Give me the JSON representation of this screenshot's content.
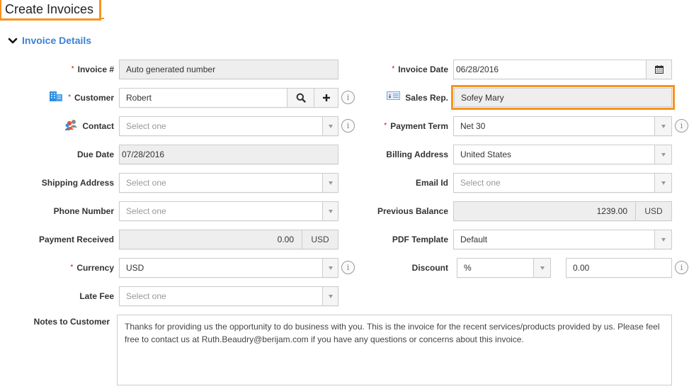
{
  "page": {
    "title": "Create Invoices"
  },
  "section": {
    "title": "Invoice Details",
    "expanded_icon": "chevron-down-icon"
  },
  "colors": {
    "accent_orange": "#f7941d",
    "section_blue": "#3b82d6",
    "required_red": "#dd0000"
  },
  "left": {
    "invoice_no": {
      "label": "Invoice #",
      "required": "*",
      "value": "Auto generated number"
    },
    "customer": {
      "label": "Customer",
      "required": "*",
      "value": "Robert",
      "icon": "building-icon",
      "search_icon": "search-icon",
      "add_icon": "plus-icon"
    },
    "contact": {
      "label": "Contact",
      "placeholder": "Select one",
      "icon": "contacts-icon"
    },
    "due_date": {
      "label": "Due Date",
      "value": "07/28/2016"
    },
    "shipping_address": {
      "label": "Shipping Address",
      "placeholder": "Select one"
    },
    "phone_number": {
      "label": "Phone Number",
      "placeholder": "Select one"
    },
    "payment_received": {
      "label": "Payment Received",
      "value": "0.00",
      "currency": "USD"
    },
    "currency": {
      "label": "Currency",
      "required": "*",
      "value": "USD"
    },
    "late_fee": {
      "label": "Late Fee",
      "placeholder": "Select one"
    }
  },
  "right": {
    "invoice_date": {
      "label": "Invoice Date",
      "required": "*",
      "value": "06/28/2016",
      "icon": "calendar-icon"
    },
    "sales_rep": {
      "label": "Sales Rep.",
      "value": "Sofey Mary",
      "icon": "id-card-icon"
    },
    "payment_term": {
      "label": "Payment Term",
      "required": "*",
      "value": "Net 30"
    },
    "billing_address": {
      "label": "Billing Address",
      "value": "United States"
    },
    "email_id": {
      "label": "Email Id",
      "placeholder": "Select one"
    },
    "previous_balance": {
      "label": "Previous Balance",
      "value": "1239.00",
      "currency": "USD"
    },
    "pdf_template": {
      "label": "PDF Template",
      "value": "Default"
    },
    "discount": {
      "label": "Discount",
      "type_value": "%",
      "amount": "0.00"
    }
  },
  "notes": {
    "label": "Notes to Customer",
    "value": "Thanks for providing us the opportunity to do business with you. This is the invoice for the recent services/products provided by us. Please feel free to contact us at Ruth.Beaudry@berijam.com if you have any questions or concerns about this invoice."
  },
  "info_glyph": "i"
}
